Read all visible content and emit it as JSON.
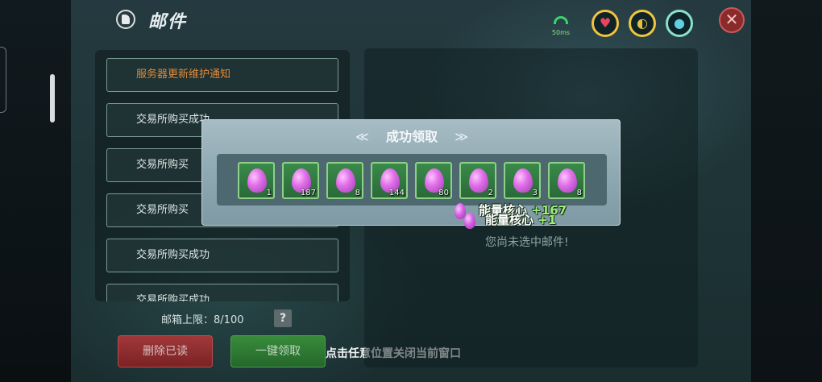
{
  "header": {
    "title": "邮件",
    "ping": "50ms"
  },
  "status_icons": [
    "signal-icon",
    "heart-icon",
    "stomach-icon",
    "water-drop-icon",
    "close-icon"
  ],
  "mail_list": {
    "items": [
      {
        "label": "服务器更新维护通知"
      },
      {
        "label": "交易所购买成功"
      },
      {
        "label": "交易所购买"
      },
      {
        "label": "交易所购买"
      },
      {
        "label": "交易所购买成功"
      },
      {
        "label": "交易所购买成功"
      }
    ],
    "capacity_label": "邮箱上限：",
    "capacity_value": "8/100",
    "help": "?"
  },
  "buttons": {
    "delete_read": "删除已读",
    "claim_all": "一键领取"
  },
  "detail": {
    "empty_text": "您尚未选中邮件!"
  },
  "popup": {
    "title": "成功领取",
    "rewards": [
      {
        "icon": "energy-core-gem",
        "qty": "1"
      },
      {
        "icon": "energy-core-gem",
        "qty": "187"
      },
      {
        "icon": "energy-core-gem",
        "qty": "8"
      },
      {
        "icon": "energy-core-gem",
        "qty": "144"
      },
      {
        "icon": "energy-core-gem",
        "qty": "80"
      },
      {
        "icon": "energy-core-gem",
        "qty": "2"
      },
      {
        "icon": "energy-core-gem",
        "qty": "3"
      },
      {
        "icon": "energy-core-gem",
        "qty": "8"
      }
    ],
    "close_hint": "点击任意位置关闭当前窗口"
  },
  "notifications": [
    {
      "name": "能量核心",
      "amount": "+167"
    },
    {
      "name": "能量核心",
      "amount": "+1"
    }
  ]
}
